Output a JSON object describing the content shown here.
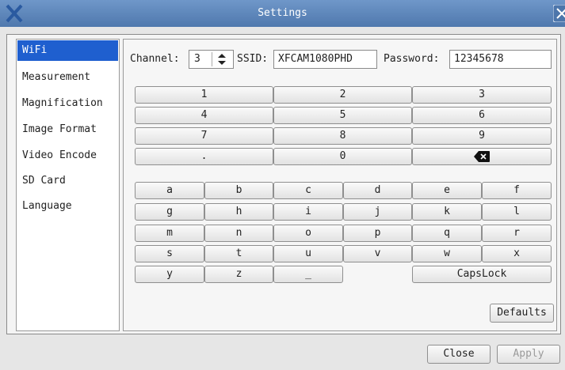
{
  "window": {
    "title": "Settings"
  },
  "sidebar": {
    "items": [
      {
        "label": "WiFi",
        "selected": true
      },
      {
        "label": "Measurement"
      },
      {
        "label": "Magnification"
      },
      {
        "label": "Image Format"
      },
      {
        "label": "Video Encode"
      },
      {
        "label": "SD Card"
      },
      {
        "label": "Language"
      }
    ]
  },
  "wifi": {
    "channel_label": "Channel:",
    "channel_value": "3",
    "ssid_label": "SSID:",
    "ssid_value": "XFCAM1080PHD",
    "password_label": "Password:",
    "password_value": "12345678"
  },
  "keypad": {
    "numeric": [
      "1",
      "2",
      "3",
      "4",
      "5",
      "6",
      "7",
      "8",
      "9",
      ".",
      "0"
    ],
    "backspace_icon": "backspace-icon",
    "letters": [
      "a",
      "b",
      "c",
      "d",
      "e",
      "f",
      "g",
      "h",
      "i",
      "j",
      "k",
      "l",
      "m",
      "n",
      "o",
      "p",
      "q",
      "r",
      "s",
      "t",
      "u",
      "v",
      "w",
      "x",
      "y",
      "z",
      "_"
    ],
    "capslock": "CapsLock"
  },
  "buttons": {
    "defaults": "Defaults",
    "close": "Close",
    "apply": "Apply",
    "apply_enabled": false
  },
  "colors": {
    "titlebar": "#5f87bd",
    "selection": "#1f5fcf"
  }
}
